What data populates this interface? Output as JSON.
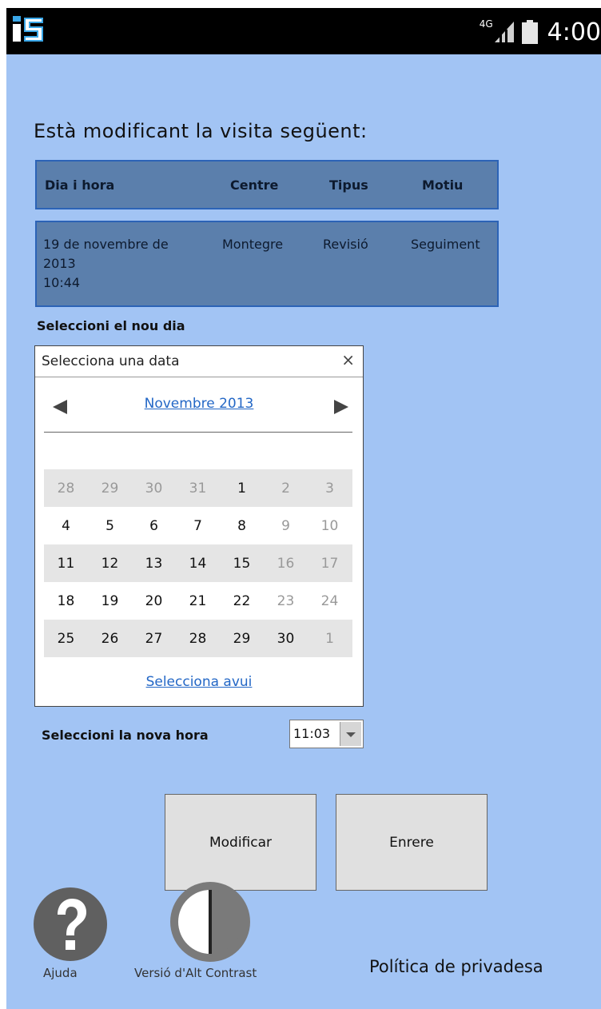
{
  "status_bar": {
    "network": "4G",
    "time": "4:00",
    "icons": [
      "app-logo-icon",
      "signal-icon",
      "battery-icon"
    ]
  },
  "heading": "Està modificant la visita següent:",
  "visit_table": {
    "headers": [
      "Dia i hora",
      "Centre",
      "Tipus",
      "Motiu"
    ],
    "row": {
      "date_line1": "19 de novembre de",
      "date_line2": "2013",
      "time": "10:44",
      "centre": "Montegre",
      "tipus": "Revisió",
      "motiu": "Seguiment"
    }
  },
  "select_day_label": "Seleccioni el nou dia",
  "datepicker": {
    "title": "Selecciona una data",
    "close": "×",
    "month": "Novembre 2013",
    "weeks": [
      [
        "28",
        "29",
        "30",
        "31",
        "1",
        "2",
        "3"
      ],
      [
        "4",
        "5",
        "6",
        "7",
        "8",
        "9",
        "10"
      ],
      [
        "11",
        "12",
        "13",
        "14",
        "15",
        "16",
        "17"
      ],
      [
        "18",
        "19",
        "20",
        "21",
        "22",
        "23",
        "24"
      ],
      [
        "25",
        "26",
        "27",
        "28",
        "29",
        "30",
        "1"
      ]
    ],
    "today_link": "Selecciona avui"
  },
  "select_hour_label": "Seleccioni la nova hora",
  "time_select": {
    "value": "11:03"
  },
  "buttons": {
    "modify": "Modificar",
    "back": "Enrere"
  },
  "footer": {
    "help_label": "Ajuda",
    "contrast_label": "Versió d'Alt Contrast",
    "privacy": "Política de privadesa"
  },
  "colors": {
    "screen_bg": "#a2c4f4",
    "table_bg": "#5b7fac",
    "table_border": "#2c63b6",
    "link": "#2367c6"
  }
}
